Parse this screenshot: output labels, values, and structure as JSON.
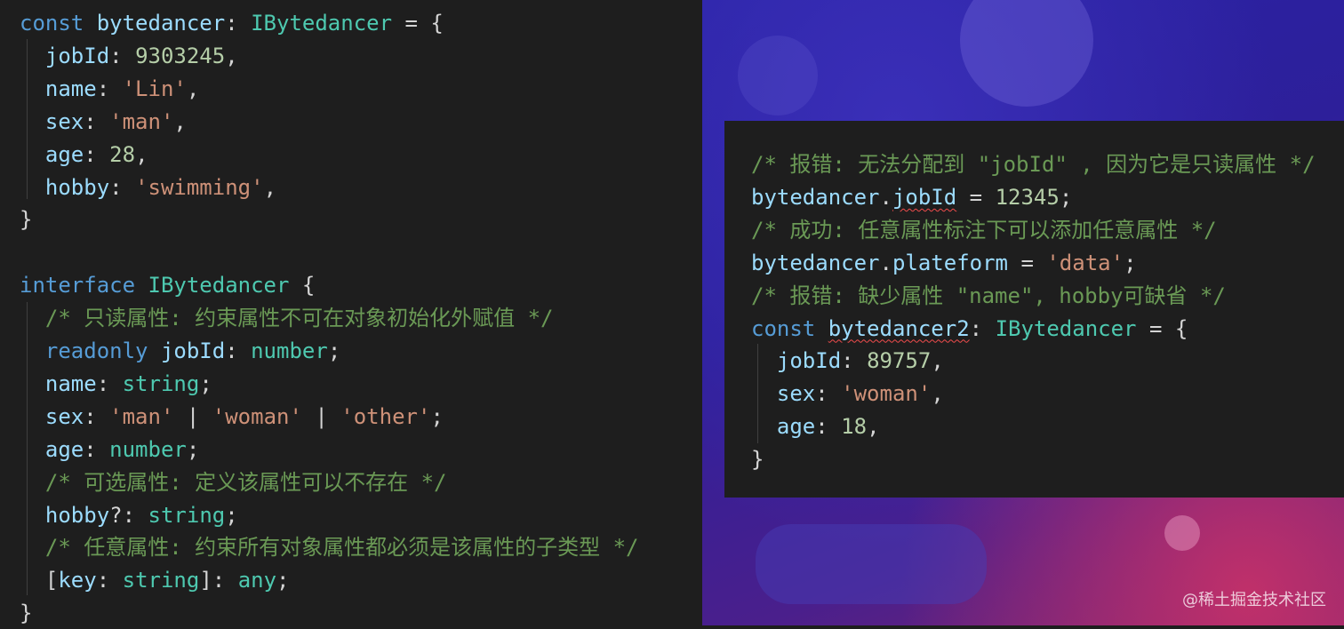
{
  "left_code": {
    "lines": [
      [
        {
          "t": "const",
          "c": "kw"
        },
        {
          "t": " ",
          "c": "pun"
        },
        {
          "t": "bytedancer",
          "c": "var"
        },
        {
          "t": ": ",
          "c": "pun"
        },
        {
          "t": "IBytedancer",
          "c": "type"
        },
        {
          "t": " = {",
          "c": "pun"
        }
      ],
      [
        {
          "t": "  jobId",
          "c": "var"
        },
        {
          "t": ": ",
          "c": "pun"
        },
        {
          "t": "9303245",
          "c": "num"
        },
        {
          "t": ",",
          "c": "pun"
        }
      ],
      [
        {
          "t": "  name",
          "c": "var"
        },
        {
          "t": ": ",
          "c": "pun"
        },
        {
          "t": "'Lin'",
          "c": "str"
        },
        {
          "t": ",",
          "c": "pun"
        }
      ],
      [
        {
          "t": "  sex",
          "c": "var"
        },
        {
          "t": ": ",
          "c": "pun"
        },
        {
          "t": "'man'",
          "c": "str"
        },
        {
          "t": ",",
          "c": "pun"
        }
      ],
      [
        {
          "t": "  age",
          "c": "var"
        },
        {
          "t": ": ",
          "c": "pun"
        },
        {
          "t": "28",
          "c": "num"
        },
        {
          "t": ",",
          "c": "pun"
        }
      ],
      [
        {
          "t": "  hobby",
          "c": "var"
        },
        {
          "t": ": ",
          "c": "pun"
        },
        {
          "t": "'swimming'",
          "c": "str"
        },
        {
          "t": ",",
          "c": "pun"
        }
      ],
      [
        {
          "t": "}",
          "c": "pun"
        }
      ],
      [],
      [
        {
          "t": "interface",
          "c": "kw"
        },
        {
          "t": " ",
          "c": "pun"
        },
        {
          "t": "IBytedancer",
          "c": "type"
        },
        {
          "t": " {",
          "c": "pun"
        }
      ],
      [
        {
          "t": "  /* 只读属性: 约束属性不可在对象初始化外赋值 */",
          "c": "com"
        }
      ],
      [
        {
          "t": "  readonly",
          "c": "kw"
        },
        {
          "t": " ",
          "c": "pun"
        },
        {
          "t": "jobId",
          "c": "var"
        },
        {
          "t": ": ",
          "c": "pun"
        },
        {
          "t": "number",
          "c": "type"
        },
        {
          "t": ";",
          "c": "pun"
        }
      ],
      [
        {
          "t": "  name",
          "c": "var"
        },
        {
          "t": ": ",
          "c": "pun"
        },
        {
          "t": "string",
          "c": "type"
        },
        {
          "t": ";",
          "c": "pun"
        }
      ],
      [
        {
          "t": "  sex",
          "c": "var"
        },
        {
          "t": ": ",
          "c": "pun"
        },
        {
          "t": "'man'",
          "c": "str"
        },
        {
          "t": " | ",
          "c": "pun"
        },
        {
          "t": "'woman'",
          "c": "str"
        },
        {
          "t": " | ",
          "c": "pun"
        },
        {
          "t": "'other'",
          "c": "str"
        },
        {
          "t": ";",
          "c": "pun"
        }
      ],
      [
        {
          "t": "  age",
          "c": "var"
        },
        {
          "t": ": ",
          "c": "pun"
        },
        {
          "t": "number",
          "c": "type"
        },
        {
          "t": ";",
          "c": "pun"
        }
      ],
      [
        {
          "t": "  /* 可选属性: 定义该属性可以不存在 */",
          "c": "com"
        }
      ],
      [
        {
          "t": "  hobby",
          "c": "var"
        },
        {
          "t": "?: ",
          "c": "pun"
        },
        {
          "t": "string",
          "c": "type"
        },
        {
          "t": ";",
          "c": "pun"
        }
      ],
      [
        {
          "t": "  /* 任意属性: 约束所有对象属性都必须是该属性的子类型 */",
          "c": "com"
        }
      ],
      [
        {
          "t": "  [",
          "c": "pun"
        },
        {
          "t": "key",
          "c": "var"
        },
        {
          "t": ": ",
          "c": "pun"
        },
        {
          "t": "string",
          "c": "type"
        },
        {
          "t": "]: ",
          "c": "pun"
        },
        {
          "t": "any",
          "c": "type"
        },
        {
          "t": ";",
          "c": "pun"
        }
      ],
      [
        {
          "t": "}",
          "c": "pun"
        }
      ]
    ]
  },
  "right_code": {
    "lines": [
      [
        {
          "t": "/* 报错: 无法分配到 \"jobId\" , 因为它是只读属性 */",
          "c": "com"
        }
      ],
      [
        {
          "t": "bytedancer",
          "c": "var"
        },
        {
          "t": ".",
          "c": "pun"
        },
        {
          "t": "jobId",
          "c": "var err"
        },
        {
          "t": " = ",
          "c": "pun"
        },
        {
          "t": "12345",
          "c": "num"
        },
        {
          "t": ";",
          "c": "pun"
        }
      ],
      [
        {
          "t": "/* 成功: 任意属性标注下可以添加任意属性 */",
          "c": "com"
        }
      ],
      [
        {
          "t": "bytedancer",
          "c": "var"
        },
        {
          "t": ".",
          "c": "pun"
        },
        {
          "t": "plateform",
          "c": "var"
        },
        {
          "t": " = ",
          "c": "pun"
        },
        {
          "t": "'data'",
          "c": "str"
        },
        {
          "t": ";",
          "c": "pun"
        }
      ],
      [
        {
          "t": "/* 报错: 缺少属性 \"name\", hobby可缺省 */",
          "c": "com"
        }
      ],
      [
        {
          "t": "const",
          "c": "kw"
        },
        {
          "t": " ",
          "c": "pun"
        },
        {
          "t": "bytedancer2",
          "c": "var err"
        },
        {
          "t": ": ",
          "c": "pun"
        },
        {
          "t": "IBytedancer",
          "c": "type"
        },
        {
          "t": " = {",
          "c": "pun"
        }
      ],
      [
        {
          "t": "  jobId",
          "c": "var"
        },
        {
          "t": ": ",
          "c": "pun"
        },
        {
          "t": "89757",
          "c": "num"
        },
        {
          "t": ",",
          "c": "pun"
        }
      ],
      [
        {
          "t": "  sex",
          "c": "var"
        },
        {
          "t": ": ",
          "c": "pun"
        },
        {
          "t": "'woman'",
          "c": "str"
        },
        {
          "t": ",",
          "c": "pun"
        }
      ],
      [
        {
          "t": "  age",
          "c": "var"
        },
        {
          "t": ": ",
          "c": "pun"
        },
        {
          "t": "18",
          "c": "num"
        },
        {
          "t": ",",
          "c": "pun"
        }
      ],
      [
        {
          "t": "}",
          "c": "pun"
        }
      ]
    ]
  },
  "watermark": "@稀土掘金技术社区",
  "colors": {
    "editor_bg": "#1e1e1e",
    "keyword": "#569cd6",
    "variable": "#9cdcfe",
    "type": "#4ec9b0",
    "number": "#b5cea8",
    "string": "#ce9178",
    "comment": "#6a9955",
    "error_underline": "#f14c4c"
  }
}
